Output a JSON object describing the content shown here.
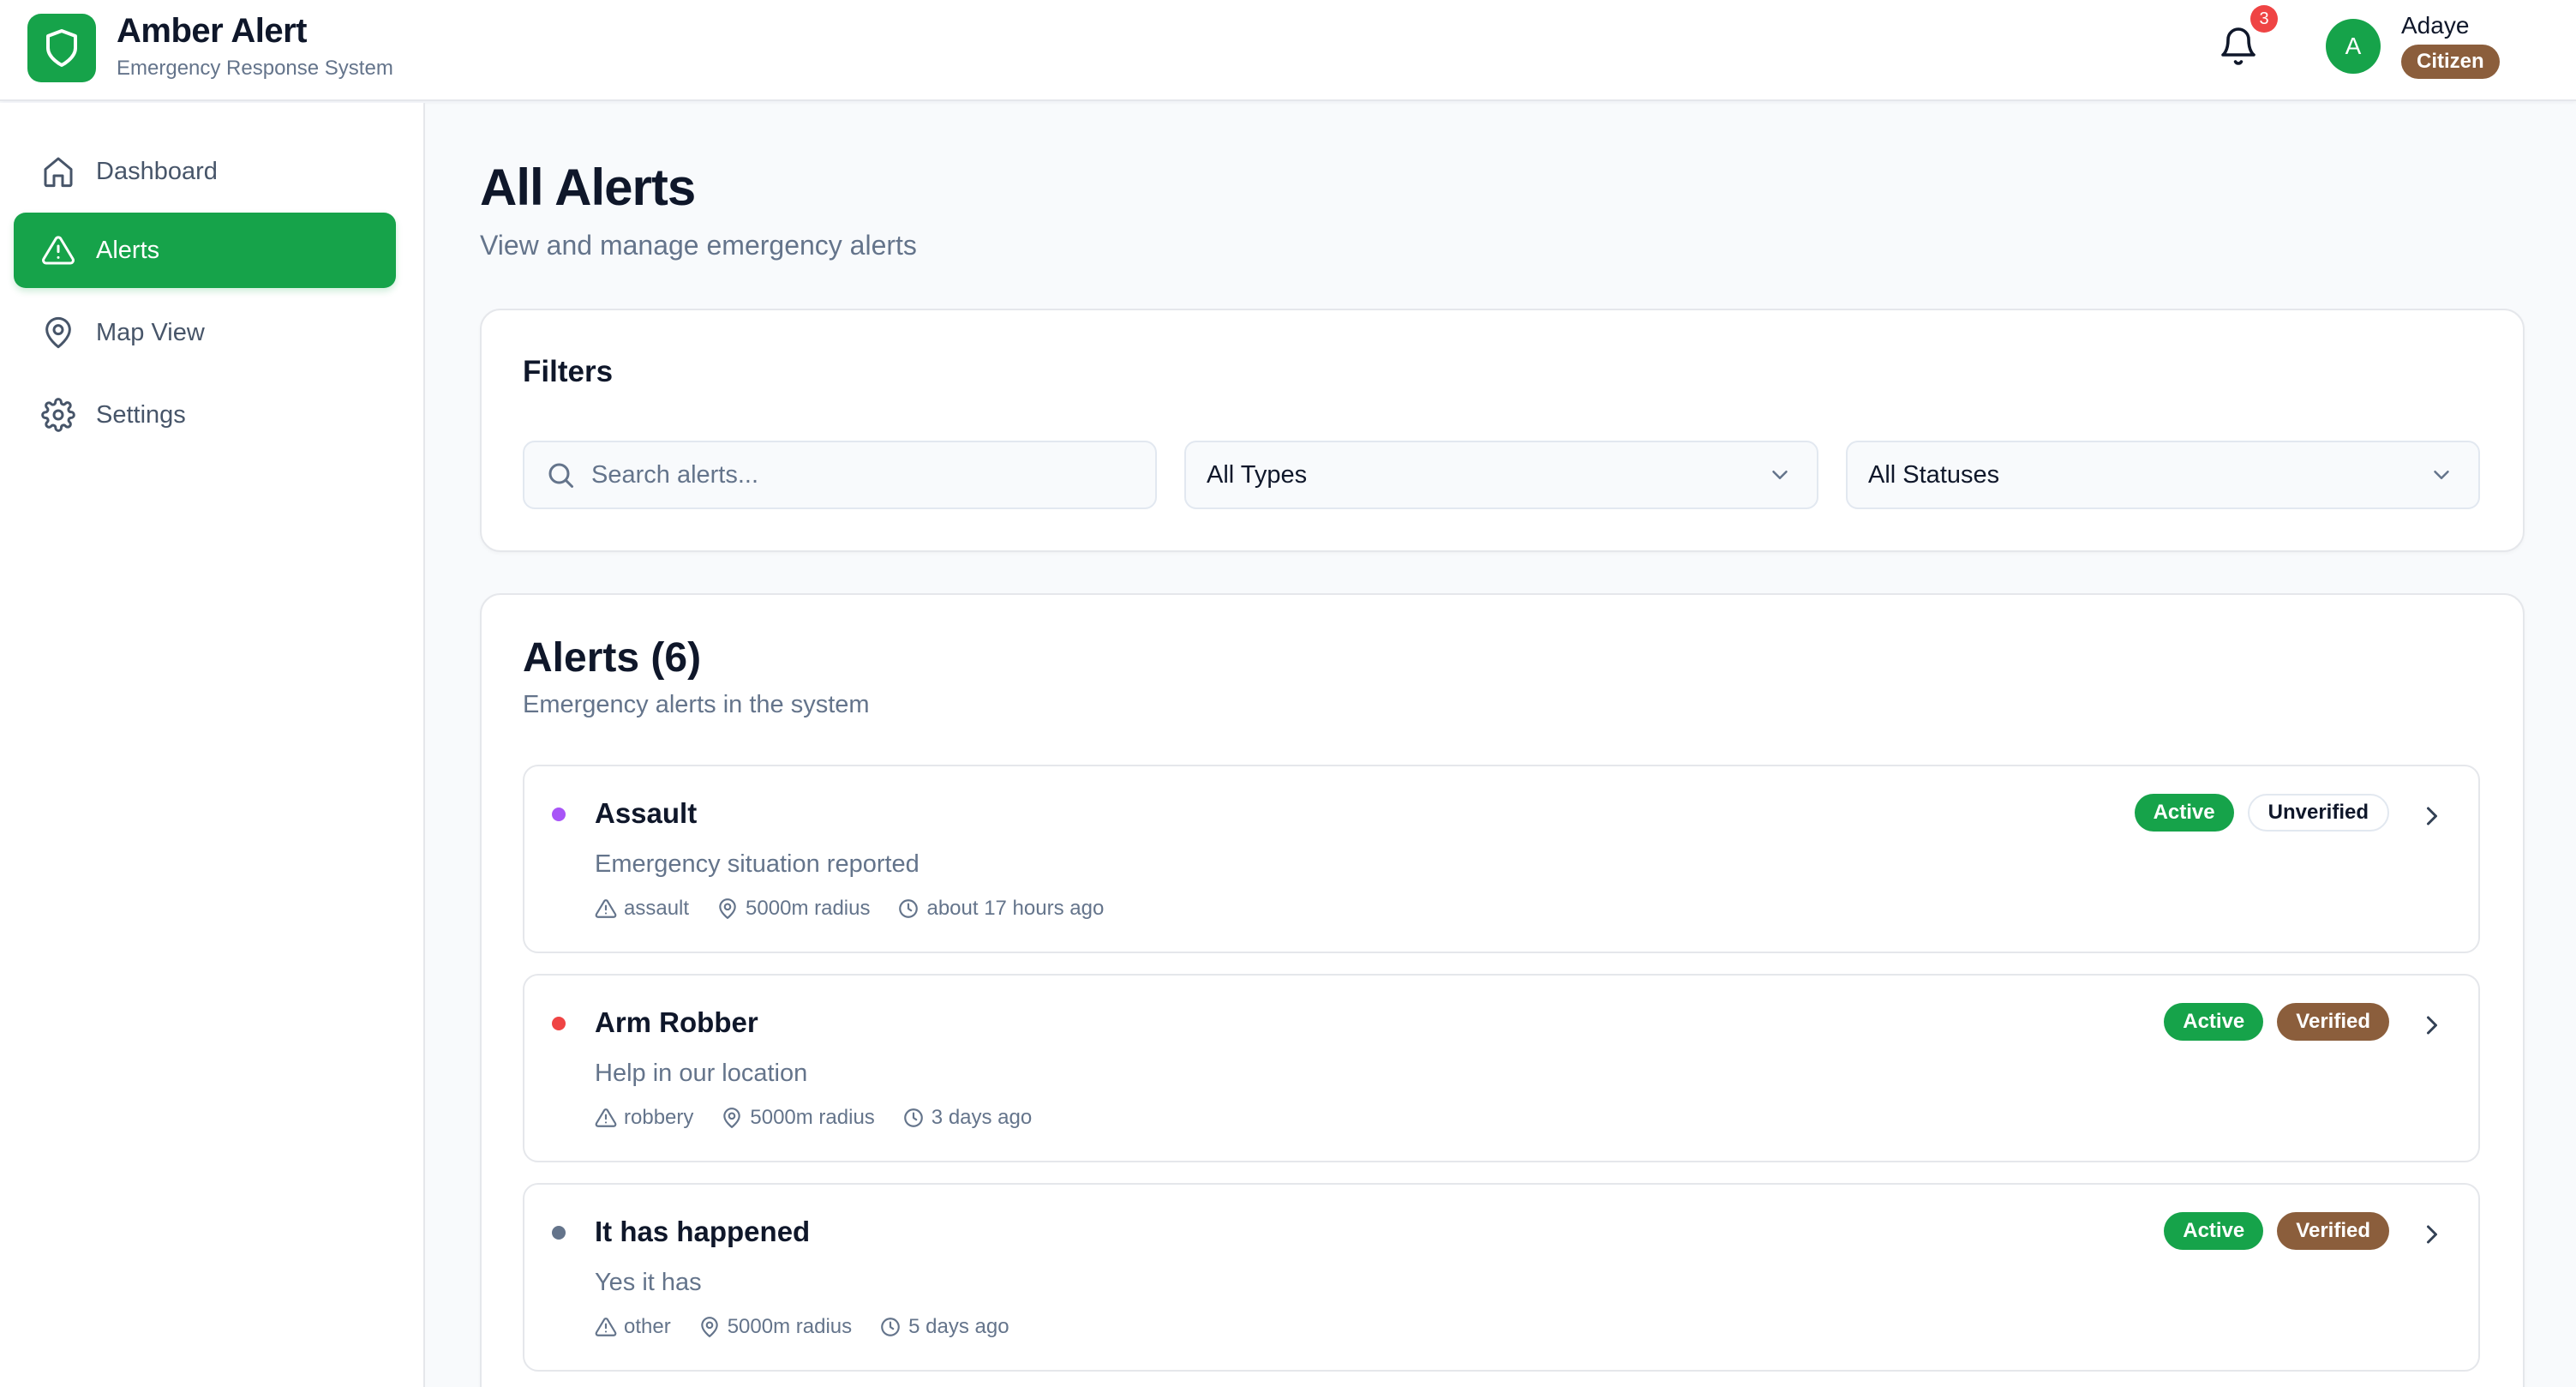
{
  "app": {
    "title": "Amber Alert",
    "subtitle": "Emergency Response System",
    "logo_icon": "shield-icon"
  },
  "header": {
    "notifications_count": "3",
    "user": {
      "initial": "A",
      "name": "Adaye",
      "role": "Citizen"
    }
  },
  "sidebar": {
    "items": [
      {
        "label": "Dashboard",
        "icon": "home-icon",
        "active": false
      },
      {
        "label": "Alerts",
        "icon": "alert-triangle-icon",
        "active": true
      },
      {
        "label": "Map View",
        "icon": "map-pin-icon",
        "active": false
      },
      {
        "label": "Settings",
        "icon": "gear-icon",
        "active": false
      }
    ]
  },
  "main": {
    "title": "All Alerts",
    "subtitle": "View and manage emergency alerts"
  },
  "filters": {
    "title": "Filters",
    "search_placeholder": "Search alerts...",
    "type_selected": "All Types",
    "status_selected": "All Statuses"
  },
  "alerts": {
    "title": "Alerts (6)",
    "subtitle": "Emergency alerts in the system",
    "items": [
      {
        "title": "Assault",
        "description": "Emergency situation reported",
        "type": "assault",
        "radius": "5000m radius",
        "time": "about 17 hours ago",
        "status": "Active",
        "verification": "Unverified",
        "dot_color": "#a855f7"
      },
      {
        "title": "Arm Robber",
        "description": "Help in our location",
        "type": "robbery",
        "radius": "5000m radius",
        "time": "3 days ago",
        "status": "Active",
        "verification": "Verified",
        "dot_color": "#ef4444"
      },
      {
        "title": "It has happened",
        "description": "Yes it has",
        "type": "other",
        "radius": "5000m radius",
        "time": "5 days ago",
        "status": "Active",
        "verification": "Verified",
        "dot_color": "#64748b"
      }
    ]
  },
  "colors": {
    "primary": "#16a34a",
    "brown": "#8b5e3c",
    "badge_red": "#ef4444"
  }
}
